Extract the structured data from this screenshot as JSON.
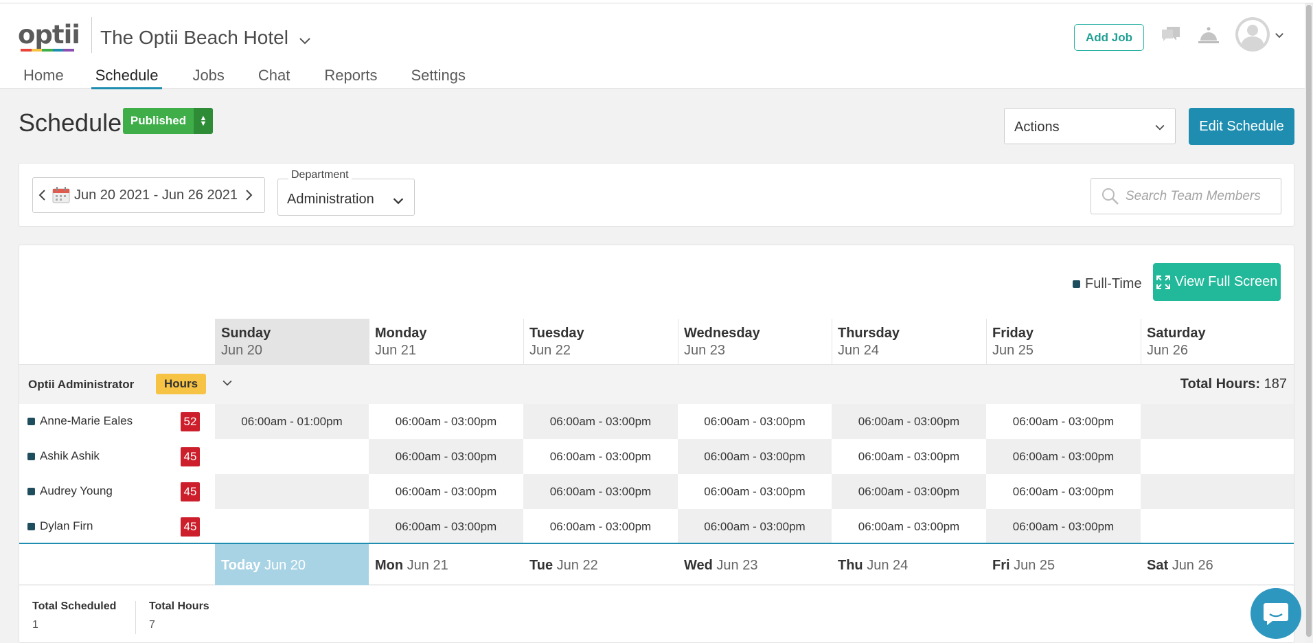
{
  "app": {
    "logo": "optii",
    "logo_colors": [
      "#e8443a",
      "#f6c344",
      "#3fae49",
      "#1f8db0",
      "#8a4fb0"
    ],
    "hotel_name": "The Optii Beach Hotel",
    "add_job_label": "Add Job"
  },
  "nav": [
    {
      "label": "Home",
      "active": false
    },
    {
      "label": "Schedule",
      "active": true
    },
    {
      "label": "Jobs",
      "active": false
    },
    {
      "label": "Chat",
      "active": false
    },
    {
      "label": "Reports",
      "active": false
    },
    {
      "label": "Settings",
      "active": false
    }
  ],
  "page": {
    "title": "Schedule",
    "status": "Published",
    "actions_label": "Actions",
    "edit_label": "Edit Schedule"
  },
  "filters": {
    "date_range": "Jun 20 2021 - Jun 26 2021",
    "department_label": "Department",
    "department_value": "Administration",
    "search_placeholder": "Search Team Members"
  },
  "schedule": {
    "legend_label": "Full-Time",
    "legend_color": "#1e4d5e",
    "fullscreen_label": "View Full Screen",
    "days": [
      {
        "name": "Sunday",
        "date": "Jun 20",
        "short": "Today",
        "today": true
      },
      {
        "name": "Monday",
        "date": "Jun 21",
        "short": "Mon",
        "today": false
      },
      {
        "name": "Tuesday",
        "date": "Jun 22",
        "short": "Tue",
        "today": false
      },
      {
        "name": "Wednesday",
        "date": "Jun 23",
        "short": "Wed",
        "today": false
      },
      {
        "name": "Thursday",
        "date": "Jun 24",
        "short": "Thu",
        "today": false
      },
      {
        "name": "Friday",
        "date": "Jun 25",
        "short": "Fri",
        "today": false
      },
      {
        "name": "Saturday",
        "date": "Jun 26",
        "short": "Sat",
        "today": false
      }
    ],
    "group": {
      "name": "Optii Administrator",
      "hours_badge": "Hours",
      "total_hours_label": "Total Hours:",
      "total_hours_value": "187"
    },
    "employees": [
      {
        "name": "Anne-Marie Eales",
        "hours": "52",
        "shifts": [
          "06:00am - 01:00pm",
          "06:00am - 03:00pm",
          "06:00am - 03:00pm",
          "06:00am - 03:00pm",
          "06:00am - 03:00pm",
          "06:00am - 03:00pm",
          ""
        ]
      },
      {
        "name": "Ashik Ashik",
        "hours": "45",
        "shifts": [
          "",
          "06:00am - 03:00pm",
          "06:00am - 03:00pm",
          "06:00am - 03:00pm",
          "06:00am - 03:00pm",
          "06:00am - 03:00pm",
          ""
        ]
      },
      {
        "name": "Audrey Young",
        "hours": "45",
        "shifts": [
          "",
          "06:00am - 03:00pm",
          "06:00am - 03:00pm",
          "06:00am - 03:00pm",
          "06:00am - 03:00pm",
          "06:00am - 03:00pm",
          ""
        ]
      },
      {
        "name": "Dylan Firn",
        "hours": "45",
        "shifts": [
          "",
          "06:00am - 03:00pm",
          "06:00am - 03:00pm",
          "06:00am - 03:00pm",
          "06:00am - 03:00pm",
          "06:00am - 03:00pm",
          ""
        ]
      }
    ],
    "summary": {
      "scheduled_label": "Total Scheduled",
      "scheduled_value": "1",
      "hours_label": "Total Hours",
      "hours_value": "7"
    }
  },
  "icons": {
    "chat": "chat-icon",
    "bell": "bell-icon",
    "avatar": "user-avatar-icon",
    "search": "search-icon",
    "calendar": "calendar-icon",
    "support": "chat-support-icon"
  }
}
